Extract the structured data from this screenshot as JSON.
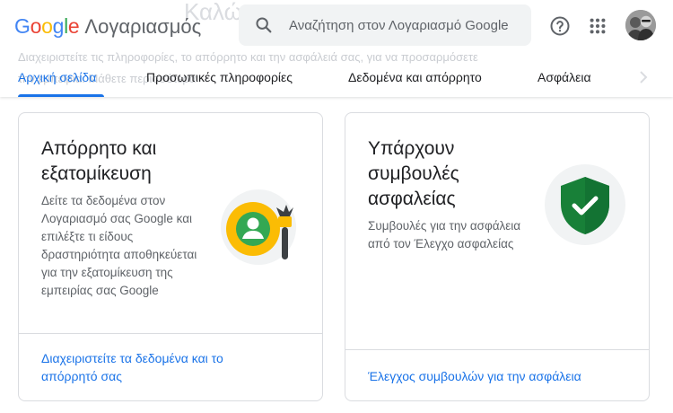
{
  "header": {
    "logo_google": "Google",
    "logo_product": "Λογαριασμός",
    "ghost_title": "Καλώς",
    "ghost_line1": "Διαχειριστείτε τις πληροφορίες, το απόρρητο και την ασφάλειά σας, για να προσαρμόσετε",
    "ghost_line2": "την εμπειρία. Μάθετε περισσότερα",
    "search": {
      "placeholder": "Αναζήτηση στον Λογαριασμό Google"
    }
  },
  "tabs": [
    {
      "label": "Αρχική σελίδα",
      "active": true
    },
    {
      "label": "Προσωπικές πληροφορίες"
    },
    {
      "label": "Δεδομένα και απόρρητο"
    },
    {
      "label": "Ασφάλεια"
    }
  ],
  "cards": {
    "privacy": {
      "title": "Απόρρητο και εξατομίκευση",
      "description": "Δείτε τα δεδομένα στον Λογαριασμό σας Google και επιλέξτε τι είδους δραστηριότητα αποθηκεύεται για την εξατομίκευση της εμπειρίας σας Google",
      "link": "Διαχειριστείτε τα δεδομένα και το απόρρητό σας"
    },
    "security": {
      "title": "Υπάρχουν συμβουλές ασφαλείας",
      "description": "Συμβουλές για την ασφάλεια από τον Έλεγχο ασφαλείας",
      "link": "Έλεγχος συμβουλών για την ασφάλεια"
    }
  },
  "colors": {
    "google_blue": "#4285f4",
    "google_red": "#ea4335",
    "google_yellow": "#fbbc04",
    "google_green": "#34a853",
    "accent": "#1a73e8"
  },
  "icons": [
    "search-icon",
    "help-icon",
    "apps-grid-icon",
    "avatar",
    "chevron-right-icon",
    "privacy-personalization-illustration",
    "security-shield-check-icon"
  ]
}
